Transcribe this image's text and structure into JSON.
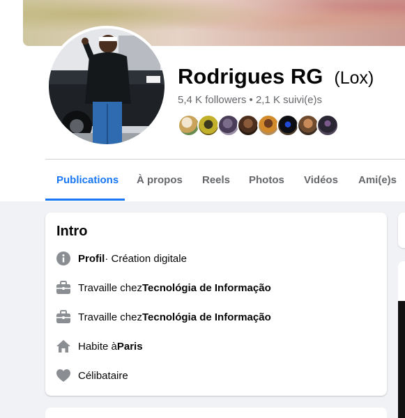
{
  "profile": {
    "name": "Rodrigues RG",
    "alternate_name": "(Lox)",
    "stats": "5,4 K followers • 2,1 K suivi(e)s",
    "friend_count_shown": 8
  },
  "tabs": [
    {
      "label": "Publications",
      "active": true
    },
    {
      "label": "À propos",
      "active": false
    },
    {
      "label": "Reels",
      "active": false
    },
    {
      "label": "Photos",
      "active": false
    },
    {
      "label": "Vidéos",
      "active": false
    },
    {
      "label": "Ami(e)s",
      "active": false
    }
  ],
  "intro": {
    "title": "Intro",
    "items": [
      {
        "icon": "info-icon",
        "bold_prefix": "Profil",
        "text": " · Création digitale"
      },
      {
        "icon": "briefcase-icon",
        "text": "Travaille chez ",
        "bold_suffix": "Tecnológia de Informação"
      },
      {
        "icon": "briefcase-icon",
        "text": "Travaille chez ",
        "bold_suffix": "Tecnológia de Informação"
      },
      {
        "icon": "home-icon",
        "text": "Habite à ",
        "bold_suffix": "Paris"
      },
      {
        "icon": "heart-icon",
        "text": "Célibataire"
      }
    ]
  },
  "colors": {
    "accent": "#1877f2",
    "secondary_text": "#65676b",
    "background": "#f0f2f5",
    "icon_gray": "#8a8d91"
  }
}
